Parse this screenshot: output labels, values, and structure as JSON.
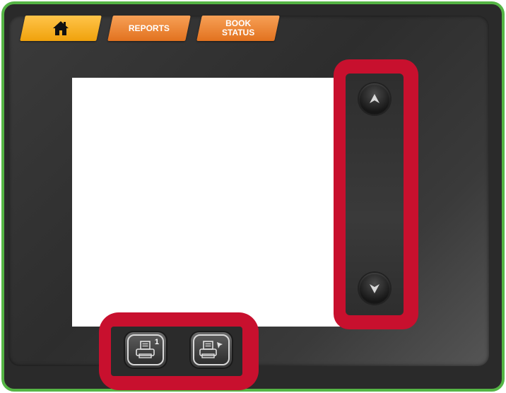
{
  "tabs": {
    "home": {
      "icon": "home-icon"
    },
    "reports": {
      "label": "REPORTS"
    },
    "book_status": {
      "label": "BOOK\nSTATUS"
    }
  },
  "scroll": {
    "up_icon": "chevron-up-icon",
    "down_icon": "chevron-down-icon"
  },
  "print": {
    "print_one": {
      "icon": "printer-icon",
      "badge": "1"
    },
    "print_select": {
      "icon": "printer-select-icon"
    }
  },
  "colors": {
    "frame_border": "#55b545",
    "highlight": "#c8102e",
    "tab_home": "#f0a20c",
    "tab_other": "#e2721f"
  }
}
